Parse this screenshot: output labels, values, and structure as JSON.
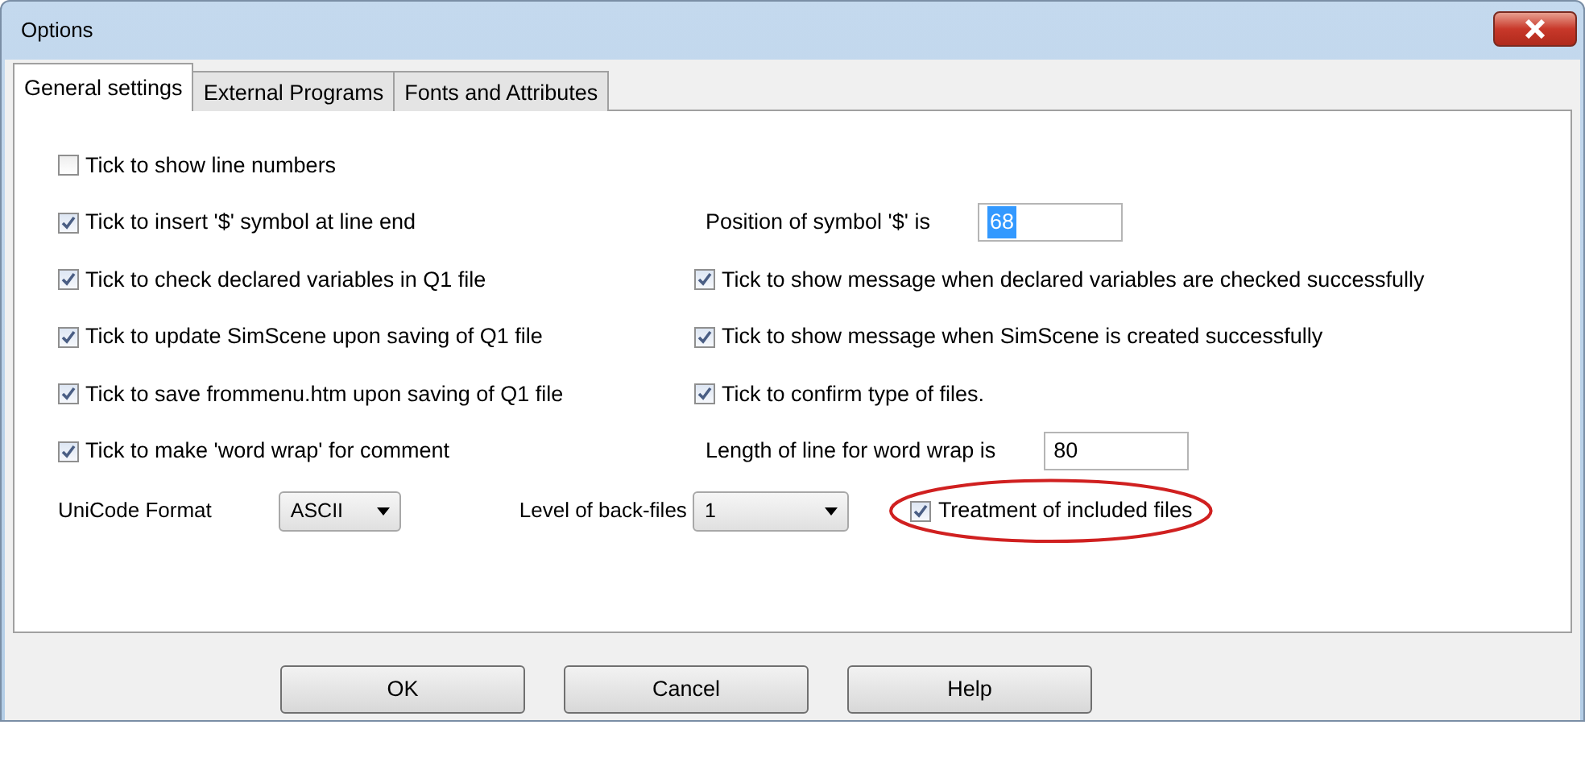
{
  "window": {
    "title": "Options"
  },
  "tabs": [
    {
      "label": "General settings",
      "selected": true
    },
    {
      "label": "External Programs",
      "selected": false
    },
    {
      "label": "Fonts and Attributes",
      "selected": false
    }
  ],
  "rows": [
    {
      "left": {
        "kind": "checkbox",
        "label": "Tick to show line numbers",
        "checked": false
      }
    },
    {
      "left": {
        "kind": "checkbox",
        "label": "Tick to insert '$' symbol at line end",
        "checked": true
      },
      "right": {
        "kind": "field",
        "label": "Position of symbol '$'  is",
        "value": "68",
        "text_selected": true
      }
    },
    {
      "left": {
        "kind": "checkbox",
        "label": "Tick to check declared variables in Q1 file",
        "checked": true
      },
      "right": {
        "kind": "checkbox",
        "label": "Tick to show message when declared variables are checked successfully",
        "checked": true
      }
    },
    {
      "left": {
        "kind": "checkbox",
        "label": "Tick to update SimScene upon saving of Q1 file",
        "checked": true
      },
      "right": {
        "kind": "checkbox",
        "label": "Tick to show message when SimScene is created successfully",
        "checked": true
      }
    },
    {
      "left": {
        "kind": "checkbox",
        "label": "Tick to save frommenu.htm upon saving of Q1 file",
        "checked": true
      },
      "right": {
        "kind": "checkbox",
        "label": "Tick to confirm type of files.",
        "checked": true
      }
    },
    {
      "left": {
        "kind": "checkbox",
        "label": "Tick to make 'word wrap' for comment",
        "checked": true
      },
      "right": {
        "kind": "field",
        "label": "Length of line for word wrap is",
        "value": "80",
        "text_selected": false
      }
    }
  ],
  "bottom_row": [
    {
      "kind": "select",
      "label": "UniCode Format",
      "value": "ASCII"
    },
    {
      "kind": "select",
      "label": "Level of back-files",
      "value": "1"
    },
    {
      "kind": "checkbox",
      "label": "Treatment of included files",
      "checked": true,
      "circled": true
    }
  ],
  "buttons": [
    "OK",
    "Cancel",
    "Help"
  ]
}
